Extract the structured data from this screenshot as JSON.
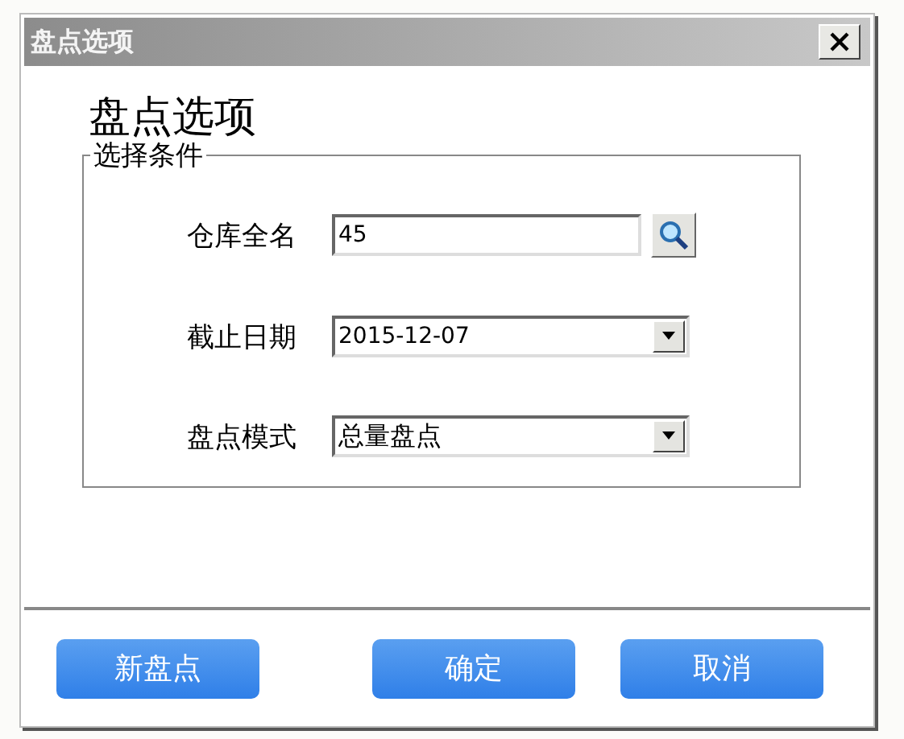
{
  "window": {
    "title": "盘点选项"
  },
  "heading": "盘点选项",
  "group": {
    "legend": "选择条件",
    "fields": [
      {
        "label": "仓库全名",
        "value": "45",
        "kind": "search"
      },
      {
        "label": "截止日期",
        "value": "2015-12-07",
        "kind": "dropdown"
      },
      {
        "label": "盘点模式",
        "value": "总量盘点",
        "kind": "dropdown"
      }
    ]
  },
  "buttons": [
    "新盘点",
    "确定",
    "取消"
  ]
}
